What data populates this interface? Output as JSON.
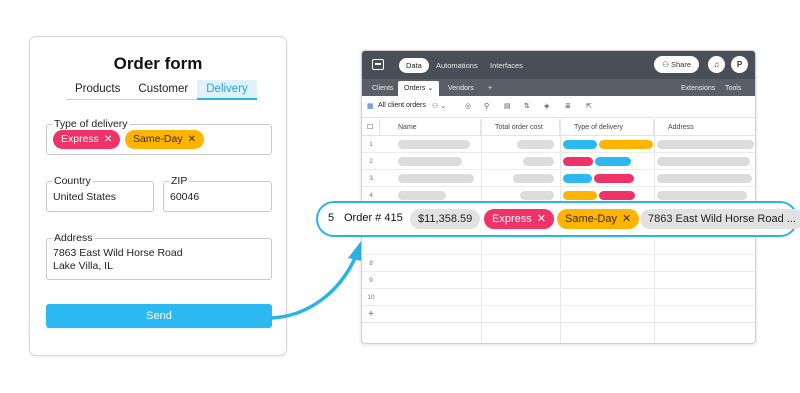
{
  "form": {
    "title": "Order form",
    "tabs": [
      {
        "label": "Products"
      },
      {
        "label": "Customer"
      },
      {
        "label": "Delivery"
      }
    ],
    "delivery_type": {
      "label": "Type of delivery",
      "chips": [
        {
          "label": "Express",
          "color": "#ef3268"
        },
        {
          "label": "Same-Day",
          "color": "#ffb400"
        }
      ]
    },
    "country": {
      "label": "Country",
      "value": "United States"
    },
    "zip": {
      "label": "ZIP",
      "value": "60046"
    },
    "address": {
      "label": "Address",
      "line1": "7863 East Wild Horse Road",
      "line2": "Lake Villa, IL"
    },
    "send_label": "Send"
  },
  "app": {
    "nav": [
      {
        "label": "Data"
      },
      {
        "label": "Automations"
      },
      {
        "label": "Interfaces"
      }
    ],
    "share_label": "Share",
    "avatar_initial": "P",
    "table_tabs": [
      {
        "label": "Clients"
      },
      {
        "label": "Orders"
      },
      {
        "label": "Vendors"
      }
    ],
    "add_tab": "+",
    "extensions_label": "Extensions",
    "tools_label": "Tools",
    "view_label": "All client orders",
    "columns": [
      {
        "label": "Name"
      },
      {
        "label": "Total order cost"
      },
      {
        "label": "Type of delivery"
      },
      {
        "label": "Address"
      }
    ],
    "row_numbers": [
      "1",
      "2",
      "3",
      "4",
      "8",
      "9",
      "10"
    ],
    "add_row": "+"
  },
  "highlight_row": {
    "number": "5",
    "name": "Order # 415",
    "cost": "$11,358.59",
    "chips": [
      {
        "label": "Express"
      },
      {
        "label": "Same-Day"
      }
    ],
    "address": "7863 East Wild Horse Road ..."
  },
  "colors": {
    "accent": "#2bb3e8",
    "express": "#ef3268",
    "same_day": "#ffb400",
    "send": "#2cb9f1"
  }
}
